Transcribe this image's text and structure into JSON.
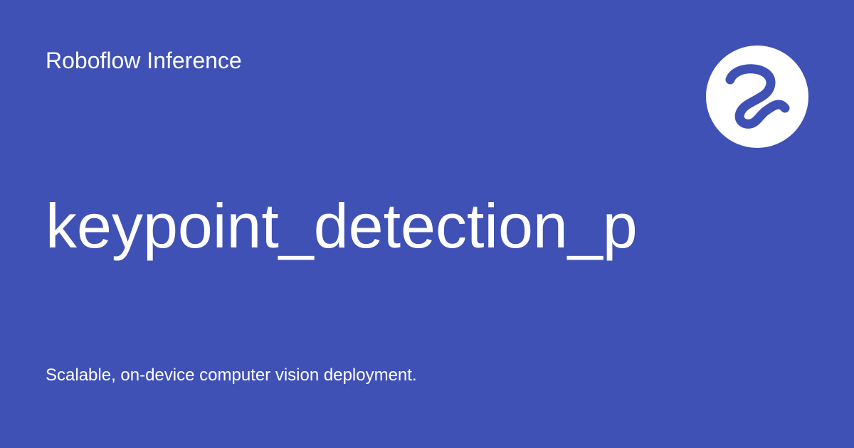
{
  "header": {
    "brand": "Roboflow Inference"
  },
  "main": {
    "title": "keypoint_detection_p"
  },
  "footer": {
    "tagline": "Scalable, on-device computer vision deployment."
  },
  "logo": {
    "icon": "roboflow-logo-icon"
  },
  "colors": {
    "background": "#3F51B5",
    "text": "#FFFFFF",
    "logo_bg": "#FFFFFF",
    "logo_mark": "#3F51B5"
  }
}
